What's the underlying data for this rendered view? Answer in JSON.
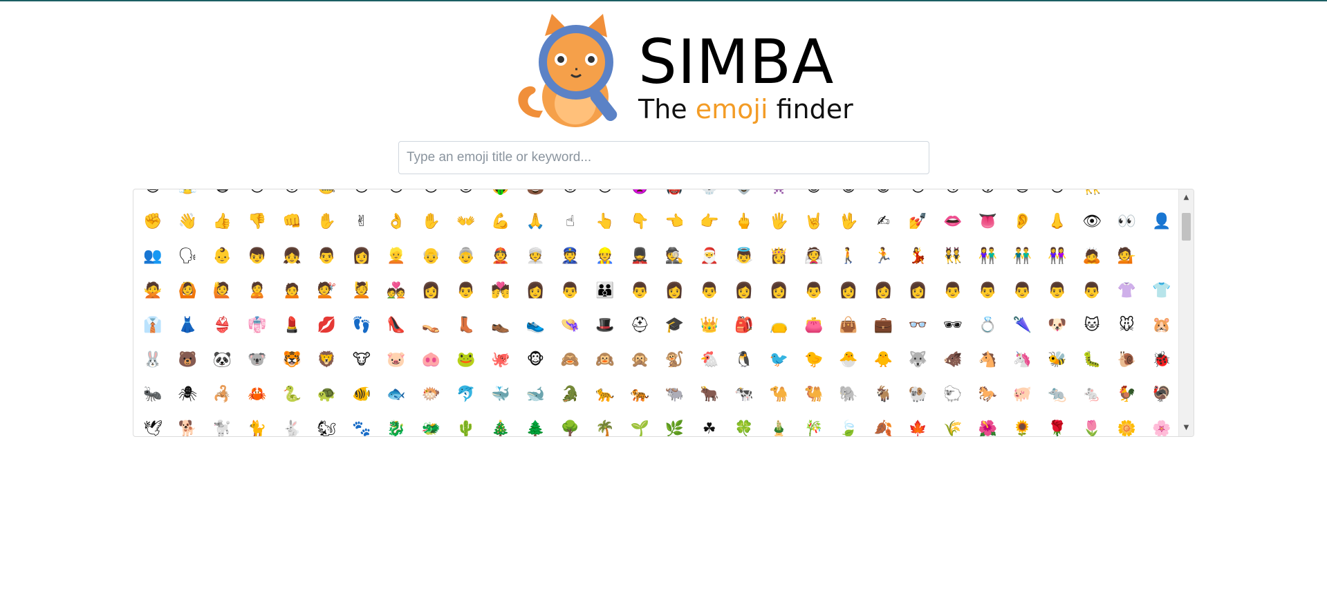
{
  "header": {
    "title": "SIMBA",
    "tagline_pre": "The ",
    "tagline_accent": "emoji",
    "tagline_post": " finder",
    "logo_icon": "cat-with-magnifier-icon",
    "accent_color": "#f39c26"
  },
  "search": {
    "placeholder": "Type an emoji title or keyword...",
    "value": ""
  },
  "emoji_rows": [
    [
      "😩",
      "😤",
      "😷",
      "😯",
      "😮",
      "🤐",
      "😶",
      "😒",
      "😔",
      "😌",
      "🤑",
      "💩",
      "😡",
      "😠",
      "👿",
      "👹",
      "💀",
      "👽",
      "👾",
      "😺",
      "😸",
      "😹",
      "😻",
      "😼",
      "😽",
      "🙀",
      "😿",
      "👯"
    ],
    [
      "✊",
      "👋",
      "👍",
      "👎",
      "👊",
      "✋",
      "✌",
      "👌",
      "✋",
      "👐",
      "💪",
      "🙏",
      "☝",
      "👆",
      "👇",
      "👈",
      "👉",
      "🖕",
      "🖐",
      "🤘",
      "🖖",
      "✍",
      "💅",
      "👄",
      "👅",
      "👂",
      "👃",
      "👁",
      "👀",
      "👤"
    ],
    [
      "👥",
      "🗣",
      "👶",
      "👦",
      "👧",
      "👨",
      "👩",
      "👱",
      "👴",
      "👵",
      "👲",
      "👳",
      "👮",
      "👷",
      "💂",
      "🕵",
      "🎅",
      "👼",
      "👸",
      "👰",
      "🚶",
      "🏃",
      "💃",
      "👯",
      "👫",
      "👬",
      "👭",
      "🙇",
      "💁"
    ],
    [
      "🙅",
      "🙆",
      "🙋",
      "🙎",
      "🙍",
      "💇",
      "💆",
      "💑",
      "👩",
      "👨",
      "💏",
      "👩",
      "👨",
      "👪",
      "👨",
      "👩",
      "👨",
      "👩",
      "👩",
      "👨",
      "👩",
      "👩",
      "👩",
      "👨",
      "👨",
      "👨",
      "👨",
      "👨",
      "👚",
      "👕",
      "👖"
    ],
    [
      "👔",
      "👗",
      "👙",
      "👘",
      "💄",
      "💋",
      "👣",
      "👠",
      "👡",
      "👢",
      "👞",
      "👟",
      "👒",
      "🎩",
      "⛑",
      "🎓",
      "👑",
      "🎒",
      "👝",
      "👛",
      "👜",
      "💼",
      "👓",
      "🕶",
      "💍",
      "🌂",
      "🐶",
      "🐱",
      "🐭",
      "🐹"
    ],
    [
      "🐰",
      "🐻",
      "🐼",
      "🐨",
      "🐯",
      "🦁",
      "🐮",
      "🐷",
      "🐽",
      "🐸",
      "🐙",
      "🐵",
      "🙈",
      "🙉",
      "🙊",
      "🐒",
      "🐔",
      "🐧",
      "🐦",
      "🐤",
      "🐣",
      "🐥",
      "🐺",
      "🐗",
      "🐴",
      "🦄",
      "🐝",
      "🐛",
      "🐌",
      "🐞"
    ],
    [
      "🐜",
      "🕷",
      "🦂",
      "🦀",
      "🐍",
      "🐢",
      "🐠",
      "🐟",
      "🐡",
      "🐬",
      "🐳",
      "🐋",
      "🐊",
      "🐆",
      "🐅",
      "🐃",
      "🐂",
      "🐄",
      "🐪",
      "🐫",
      "🐘",
      "🐐",
      "🐏",
      "🐑",
      "🐎",
      "🐖",
      "🐀",
      "🐁",
      "🐓",
      "🦃"
    ],
    [
      "🕊",
      "🐕",
      "🐩",
      "🐈",
      "🐇",
      "🐿",
      "🐾",
      "🐉",
      "🐲",
      "🌵",
      "🎄",
      "🌲",
      "🌳",
      "🌴",
      "🌱",
      "🌿",
      "☘",
      "🍀",
      "🎍",
      "🎋",
      "🍃",
      "🍂",
      "🍁",
      "🌾",
      "🌺",
      "🌻",
      "🌹",
      "🌷",
      "🌼",
      "🌸"
    ]
  ],
  "scrollbar": {
    "up_arrow": "▲",
    "down_arrow": "▼"
  }
}
